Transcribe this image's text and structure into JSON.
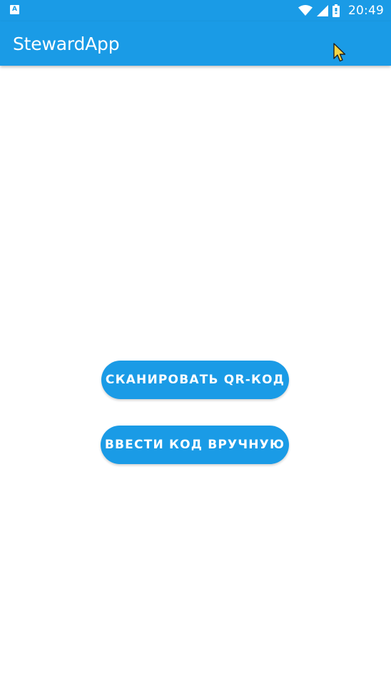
{
  "status_bar": {
    "notification_glyph": "A",
    "time": "20:49",
    "icons": [
      "notification-a-icon",
      "wifi-icon",
      "cellular-signal-icon",
      "battery-icon"
    ]
  },
  "app_bar": {
    "title": "StewardApp",
    "color": "#1a9be6"
  },
  "actions": {
    "scan_qr_label": "СКАНИРОВАТЬ QR-КОД",
    "enter_code_label": "ВВЕСТИ КОД ВРУЧНУЮ"
  },
  "colors": {
    "accent": "#1a9be6",
    "background": "#ffffff",
    "on_accent": "#ffffff"
  }
}
